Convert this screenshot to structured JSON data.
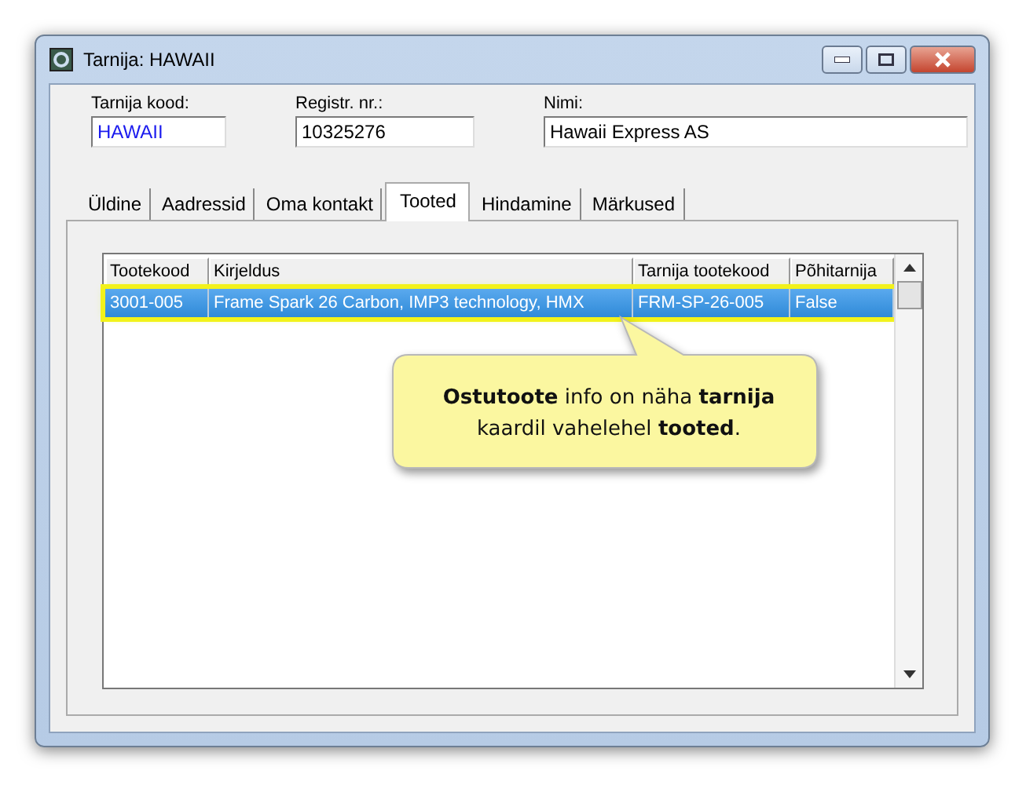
{
  "window": {
    "title": "Tarnija: HAWAII"
  },
  "fields": [
    {
      "label": "Tarnija kood:",
      "value": "HAWAII",
      "kind": "code"
    },
    {
      "label": "Registr. nr.:",
      "value": "10325276",
      "kind": "plain"
    },
    {
      "label": "Nimi:",
      "value": "Hawaii Express AS",
      "kind": "wide"
    }
  ],
  "tabs": [
    {
      "label": "Üldine",
      "selected": false
    },
    {
      "label": "Aadressid",
      "selected": false
    },
    {
      "label": "Oma kontakt",
      "selected": false
    },
    {
      "label": "Tooted",
      "selected": true
    },
    {
      "label": "Hindamine",
      "selected": false
    },
    {
      "label": "Märkused",
      "selected": false
    }
  ],
  "table": {
    "columns": [
      "Tootekood",
      "Kirjeldus",
      "Tarnija tootekood",
      "Põhitarnija"
    ],
    "rows": [
      {
        "cells": [
          "3001-005",
          "Frame Spark 26 Carbon, IMP3 technology, HMX",
          "FRM-SP-26-005",
          "False"
        ],
        "selected": true
      }
    ]
  },
  "callout": {
    "text": "**Ostutoote** info on näha **tarnija** kaardil vahelehel **tooted**."
  }
}
